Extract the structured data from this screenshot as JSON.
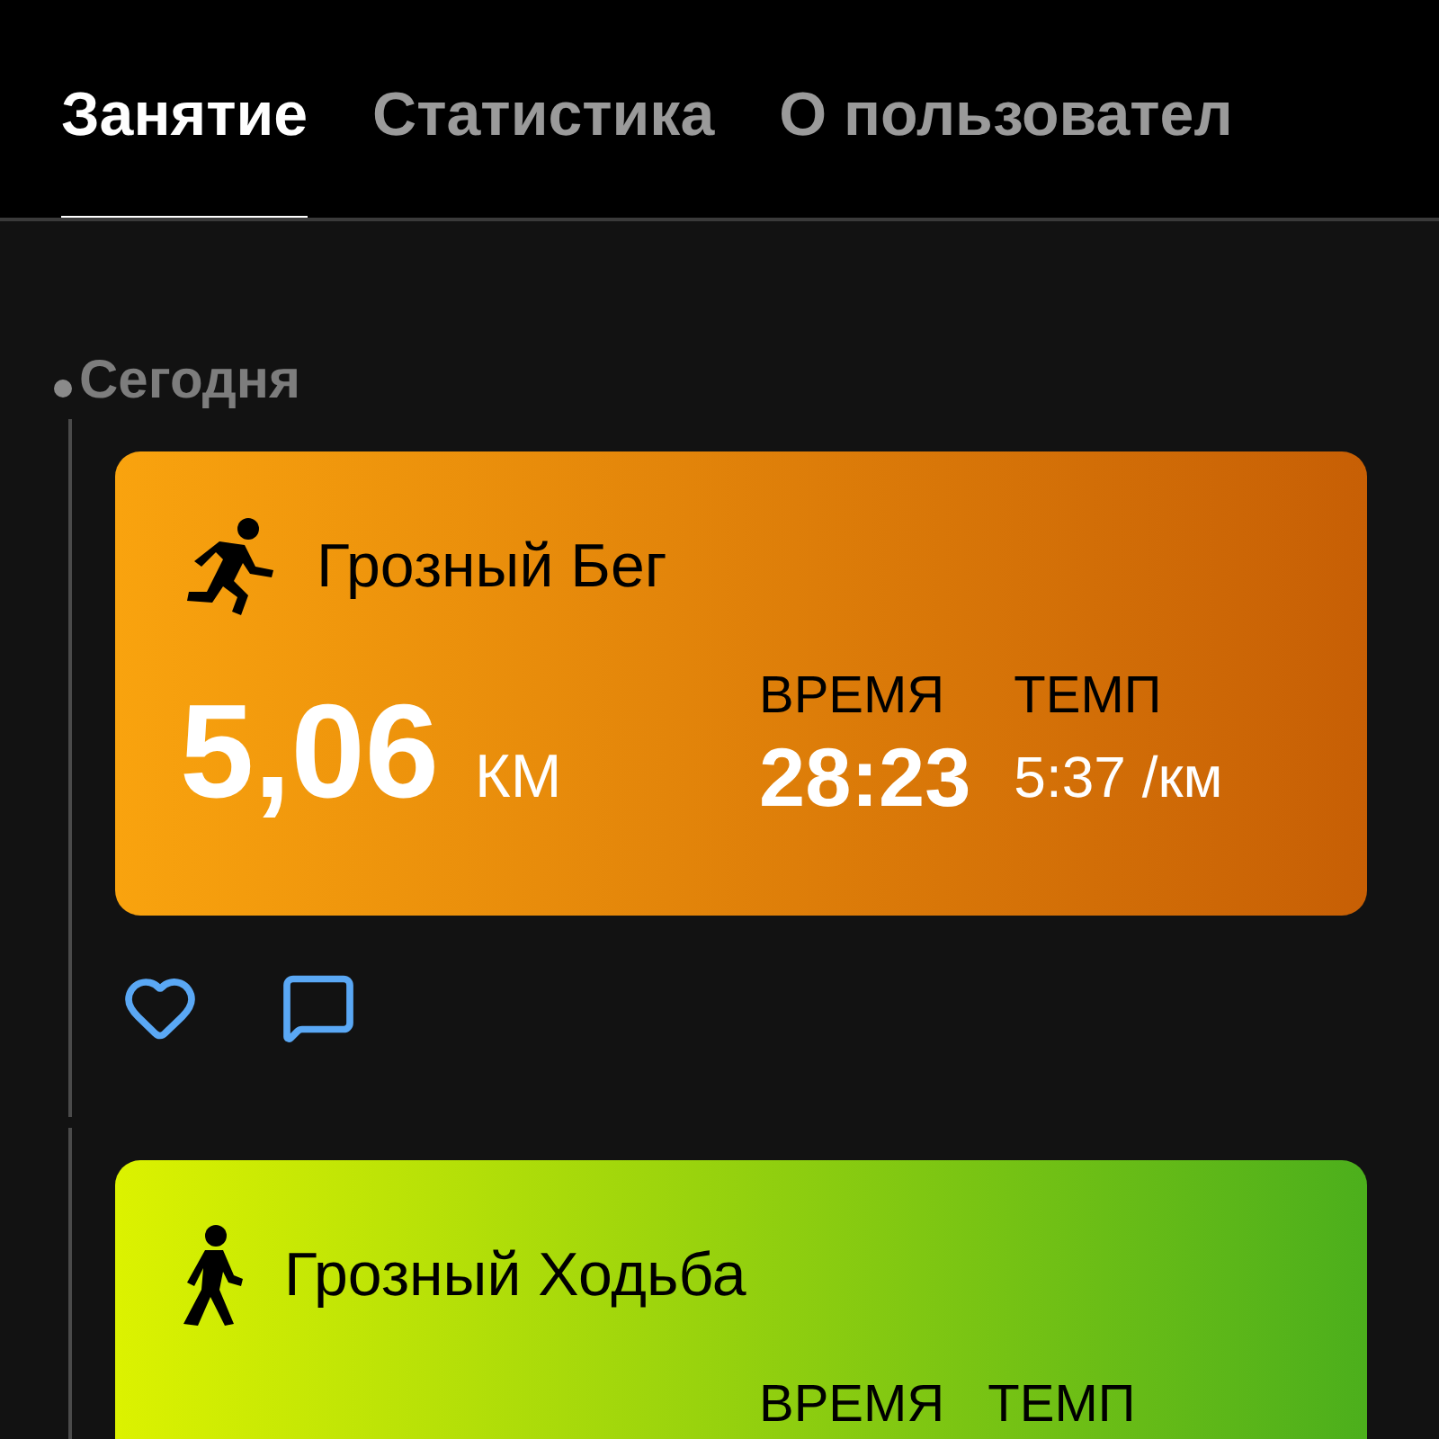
{
  "tabs": [
    {
      "label": "Занятие",
      "selected": true
    },
    {
      "label": "Статистика",
      "selected": false
    },
    {
      "label": "О пользовател",
      "selected": false
    }
  ],
  "feed": {
    "date_label": "Сегодня",
    "activities": [
      {
        "kind": "run",
        "title": "Грозный Бег",
        "distance": {
          "value": "5,06",
          "unit": "КМ"
        },
        "stats": [
          {
            "label": "ВРЕМЯ",
            "value": "28:23"
          },
          {
            "label": "ТЕМП",
            "value": "5:37 /км"
          }
        ],
        "actions": true
      },
      {
        "kind": "walk",
        "title": "Грозный Ходьба",
        "stats": [
          {
            "label": "ВРЕМЯ"
          },
          {
            "label": "ТЕМП"
          }
        ],
        "actions": false
      }
    ]
  }
}
